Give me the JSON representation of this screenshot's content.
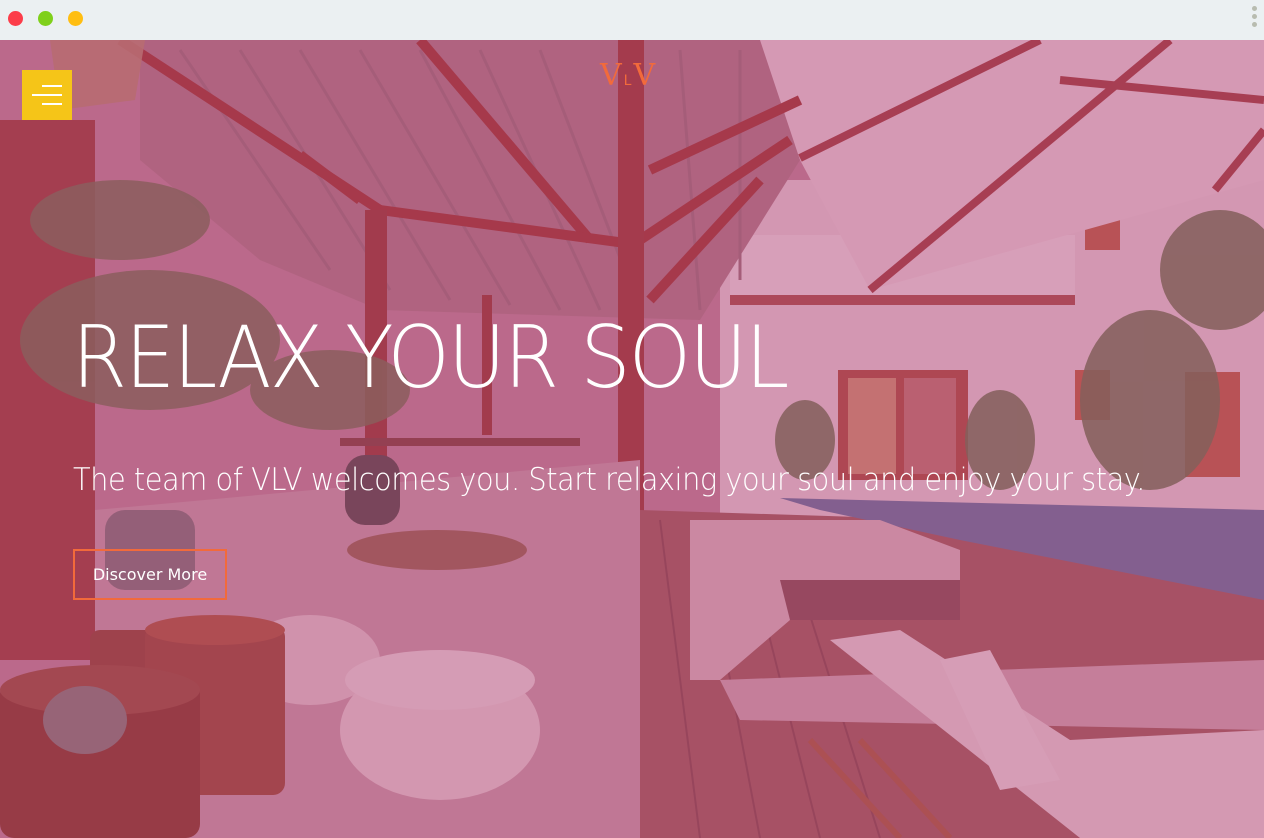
{
  "browser": {
    "close_color": "#fc3d4a",
    "minimize_color": "#7fd01b",
    "maximize_color": "#ffbe12",
    "menu_icon": "kebab-icon"
  },
  "header": {
    "menu_icon": "hamburger-menu-icon",
    "menu_color": "#f5c518",
    "logo": {
      "left": "V",
      "middle": "L",
      "right": "V",
      "color": "#f26a3b"
    }
  },
  "hero": {
    "headline": "RELAX YOUR SOUL",
    "subheadline": "The team of VLV welcomes you. Start relaxing your soul and enjoy your stay.",
    "cta_label": "Discover More",
    "cta_border_color": "#f26a3b",
    "background": "resort patio with pool, umbrellas and wooden pergola, pink overlay"
  }
}
